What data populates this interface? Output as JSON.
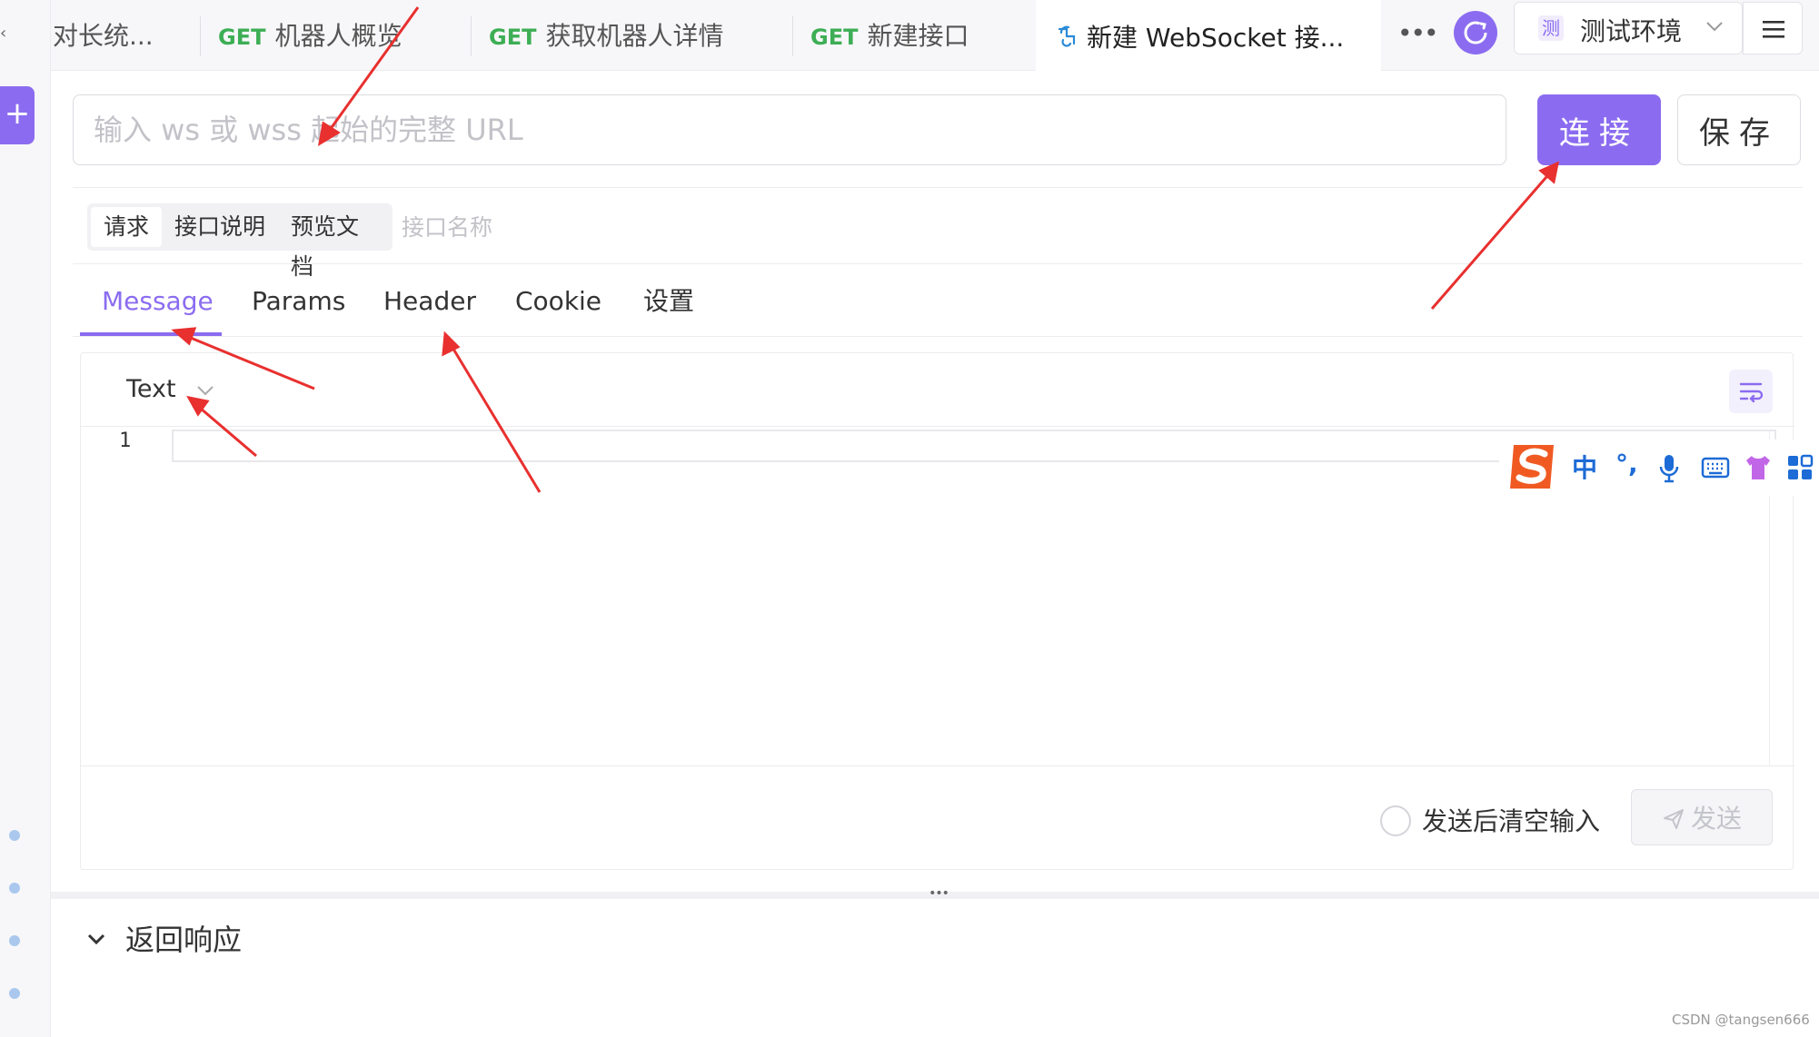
{
  "tabs": [
    {
      "method": "",
      "label": "对长统..."
    },
    {
      "method": "GET",
      "label": "机器人概览"
    },
    {
      "method": "GET",
      "label": "获取机器人详情"
    },
    {
      "method": "GET",
      "label": "新建接口"
    },
    {
      "method": "",
      "label": "新建 WebSocket 接..."
    }
  ],
  "toolbar": {
    "env_badge": "测",
    "env_label": "测试环境"
  },
  "url_bar": {
    "placeholder": "输入 ws 或 wss 起始的完整 URL",
    "connect_label": "连接",
    "save_label": "保存"
  },
  "segments": {
    "request": "请求",
    "description": "接口说明",
    "preview": "预览文档",
    "name_placeholder": "接口名称"
  },
  "subtabs": {
    "message": "Message",
    "params": "Params",
    "header": "Header",
    "cookie": "Cookie",
    "settings": "设置"
  },
  "editor": {
    "format": "Text",
    "line_number": "1",
    "clear_after_send": "发送后清空输入",
    "send_label": "发送"
  },
  "ime": {
    "lang": "中",
    "punct": "°,"
  },
  "response": {
    "label": "返回响应"
  },
  "watermark": "CSDN @tangsen666",
  "colors": {
    "accent": "#8b6cf0",
    "get_method": "#3dae55",
    "annotation": "#e8302f",
    "ime_blue": "#1d6bd6"
  }
}
